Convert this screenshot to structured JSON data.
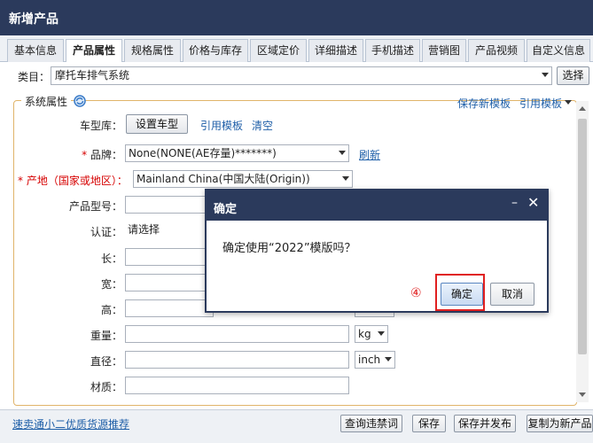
{
  "window": {
    "title": "新增产品"
  },
  "tabs": [
    {
      "label": "基本信息"
    },
    {
      "label": "产品属性"
    },
    {
      "label": "规格属性"
    },
    {
      "label": "价格与库存"
    },
    {
      "label": "区域定价"
    },
    {
      "label": "详细描述"
    },
    {
      "label": "手机描述"
    },
    {
      "label": "营销图"
    },
    {
      "label": "产品视频"
    },
    {
      "label": "自定义信息"
    }
  ],
  "category": {
    "label": "类目：",
    "value": "摩托车排气系统",
    "choose_label": "选择"
  },
  "system_attrs": {
    "legend": "系统属性",
    "save_template": "保存新模板",
    "use_template": "引用模板"
  },
  "fields": {
    "model_lib": {
      "label": "车型库：",
      "button": "设置车型",
      "use_template": "引用模板",
      "clear": "清空"
    },
    "brand": {
      "star": "* ",
      "label": "品牌：",
      "value": "None(NONE(AE存量)*******)",
      "refresh": "刷新"
    },
    "origin": {
      "label": "* 产地（国家或地区）：",
      "value": "Mainland China(中国大陆(Origin))"
    },
    "model_no": {
      "label": "产品型号："
    },
    "cert": {
      "label": "认证：",
      "value": "请选择"
    },
    "length": {
      "label": "长："
    },
    "width": {
      "label": "宽："
    },
    "height": {
      "label": "高："
    },
    "weight": {
      "label": "重量：",
      "unit": "kg"
    },
    "diameter": {
      "label": "直径：",
      "unit": "inch"
    },
    "material": {
      "label": "材质："
    }
  },
  "footer": {
    "link": "速卖通小二优质货源推荐",
    "check_banned": "查询违禁词",
    "save": "保存",
    "save_publish": "保存并发布",
    "copy_new": "复制为新产品"
  },
  "dialog": {
    "title": "确定",
    "message": "确定使用“2022”模版吗？",
    "step": "④",
    "ok": "确定",
    "cancel": "取消"
  }
}
